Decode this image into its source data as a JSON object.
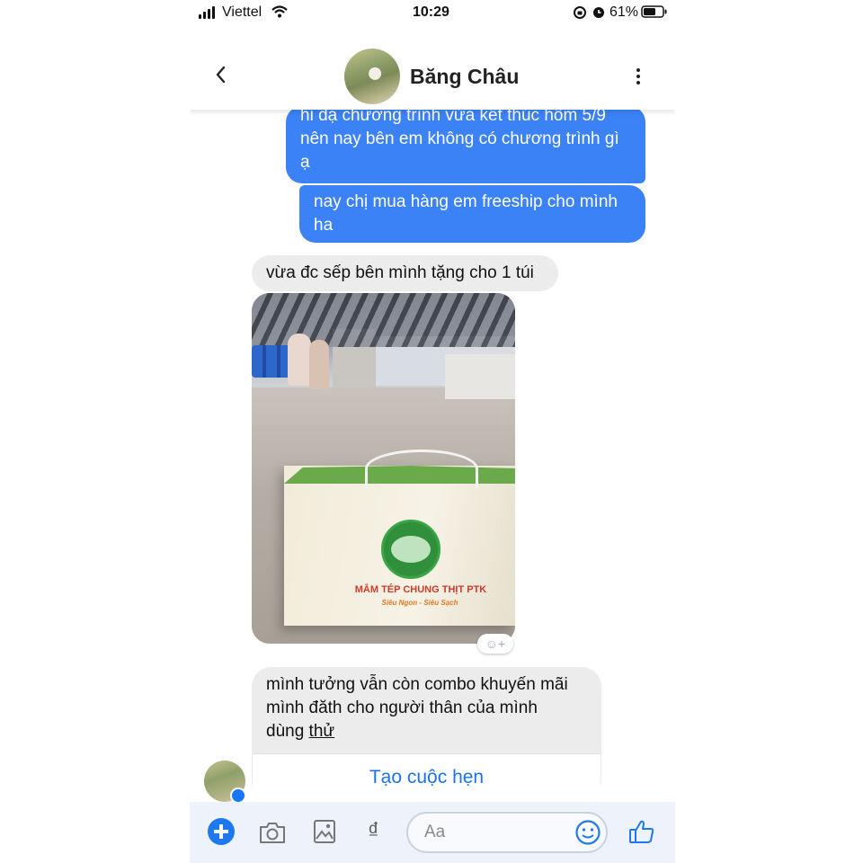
{
  "status_bar": {
    "carrier": "Viettel",
    "time": "10:29",
    "battery_percent": "61%"
  },
  "header": {
    "contact_name": "Băng Châu"
  },
  "messages": {
    "out_1_lines": [
      "hi dạ chương trình vừa kết thúc hôm 5/9",
      "nên nay bên em không có chương trình gì",
      "ạ"
    ],
    "out_2_lines": [
      "nay chị mua hàng em freeship cho mình",
      "ha"
    ],
    "in_1": "vừa đc sếp bên mình tặng cho 1 túi",
    "in_2_lines": [
      "mình tưởng vẫn còn combo khuyến mãi",
      "mình đăth cho người thân của mình"
    ],
    "in_2_last_prefix": "dùng ",
    "in_2_last_link": "thử",
    "appointment_action": "Tạo cuộc hẹn"
  },
  "photo": {
    "bag_brand": "MẮM TÉP CHUNG THỊT PTK",
    "bag_slogan": "Siêu Ngon - Siêu Sạch"
  },
  "composer": {
    "currency_symbol": "₫",
    "input_placeholder": "Aa"
  },
  "colors": {
    "accent": "#1e78f0",
    "outgoing_bubble": "#3b82f6",
    "incoming_bubble": "#ececec"
  },
  "icons": [
    "back-chevron-icon",
    "more-vertical-icon",
    "plus-icon",
    "camera-icon",
    "image-icon",
    "emoji-icon",
    "thumbs-up-icon",
    "messenger-badge-icon",
    "reaction-add-icon"
  ]
}
